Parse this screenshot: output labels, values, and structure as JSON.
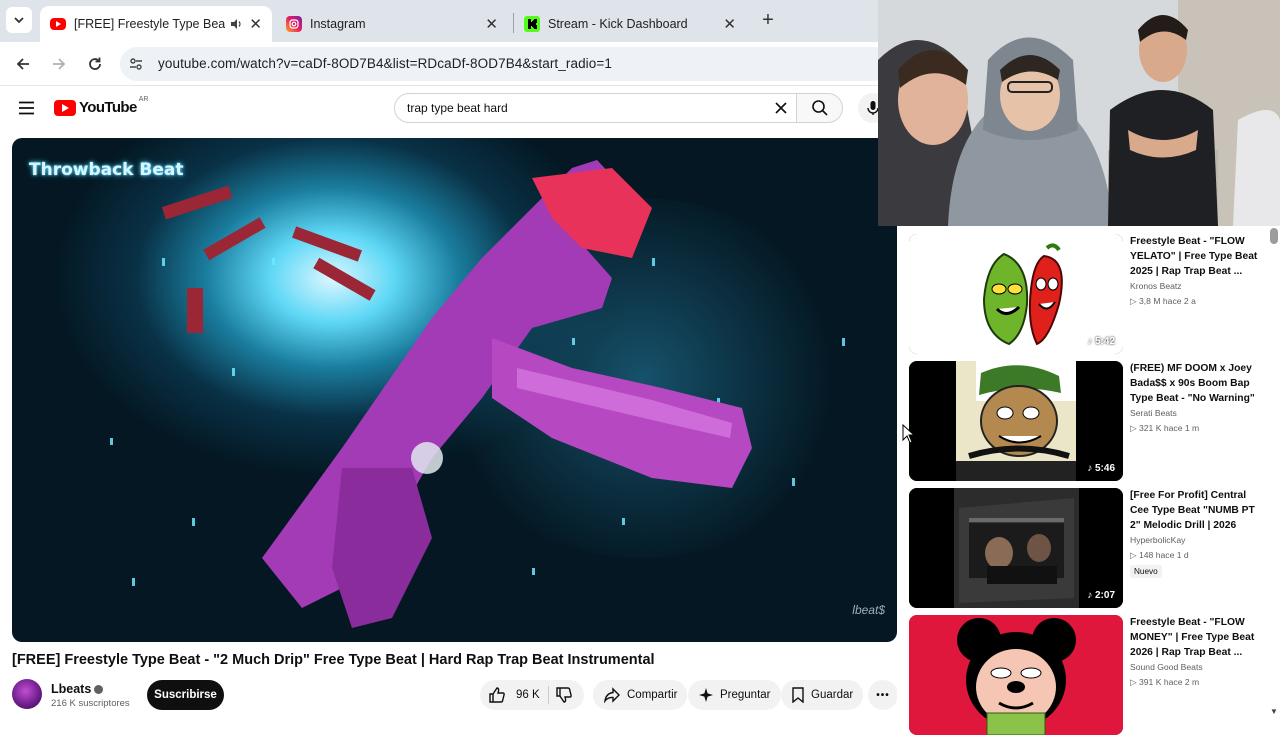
{
  "browser": {
    "tabs": [
      {
        "title": "[FREE] Freestyle Type Beat -",
        "favicon": "youtube-icon",
        "active": true,
        "audible": true
      },
      {
        "title": "Instagram",
        "favicon": "instagram-icon",
        "active": false
      },
      {
        "title": "Stream - Kick Dashboard",
        "favicon": "kick-icon",
        "active": false
      }
    ],
    "url": "youtube.com/watch?v=caDf-8OD7B4&list=RDcaDf-8OD7B4&start_radio=1"
  },
  "youtube": {
    "logo_text": "YouTube",
    "country_code": "AR",
    "search_query": "trap type beat hard"
  },
  "video": {
    "thumbnail_badge": "Throwback Beat",
    "watermark": "lbeat$",
    "title": "[FREE] Freestyle Type Beat - \"2 Much Drip\" Free Type Beat | Hard Rap Trap Beat Instrumental",
    "channel": "Lbeats",
    "subscribers": "216 K suscriptores",
    "subscribe_label": "Suscribirse",
    "likes": "96 K",
    "share_label": "Compartir",
    "ask_label": "Preguntar",
    "save_label": "Guardar",
    "more_label": "•••"
  },
  "sidebar": {
    "items": [
      {
        "title": "Freestyle Beat - \"FLOW YELATO\" | Free Type Beat 2025 | Rap Trap Beat ...",
        "channel": "Kronos Beatz",
        "meta": "3,8 M  hace 2 a",
        "duration": "5:42"
      },
      {
        "title": "(FREE) MF DOOM x Joey Bada$$ x 90s Boom Bap Type Beat - \"No Warning\"",
        "channel": "Serati Beats",
        "meta": "321 K  hace 1 m",
        "duration": "5:46"
      },
      {
        "title": "[Free For Profit] Central Cee Type Beat \"NUMB PT 2\" Melodic Drill | 2026",
        "channel": "HyperbolicKay",
        "meta": "148  hace 1 d",
        "badge": "Nuevo",
        "duration": "2:07"
      },
      {
        "title": "Freestyle Beat - \"FLOW MONEY\" | Free Type Beat 2026 | Rap Trap Beat ...",
        "channel": "Sound Good Beats",
        "meta": "391 K  hace 2 m",
        "duration": ""
      }
    ]
  },
  "colors": {
    "youtube_red": "#ff0000",
    "gun_magenta": "#b13bbd",
    "glow_cyan": "#4ad3ff"
  }
}
